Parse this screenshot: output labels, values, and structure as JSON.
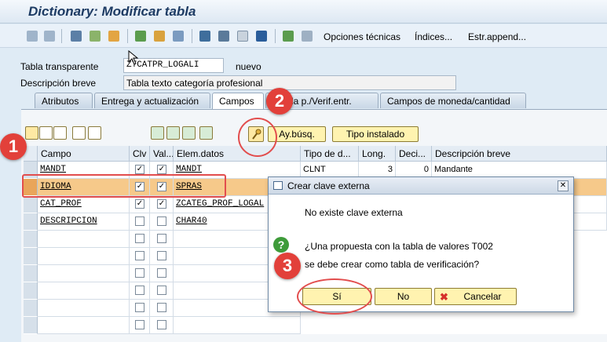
{
  "window": {
    "title": "Dictionary: Modificar tabla"
  },
  "toolbar": {
    "menu_items": [
      "Opciones técnicas",
      "Índices...",
      "Estr.append..."
    ]
  },
  "header": {
    "table_type_label": "Tabla transparente",
    "table_name": "ZTCATPR_LOGALI",
    "status": "nuevo",
    "desc_label": "Descripción breve",
    "desc_value": "Tabla texto categoría profesional"
  },
  "tabs": [
    "Atributos",
    "Entrega y actualización",
    "Campos",
    "da p./Verif.entr.",
    "Campos de moneda/cantidad"
  ],
  "active_tab": "Campos",
  "fields_toolbar": {
    "search_help_button": "Ay.búsq.",
    "builtin_type_button": "Tipo instalado"
  },
  "grid": {
    "columns": [
      "Campo",
      "Clv",
      "Val...",
      "Elem.datos",
      "Tipo de d...",
      "Long.",
      "Deci...",
      "Descripción breve"
    ],
    "rows": [
      {
        "campo": "MANDT",
        "clv": true,
        "val": true,
        "elem": "MANDT",
        "tipo": "CLNT",
        "long": "3",
        "deci": "0",
        "desc": "Mandante"
      },
      {
        "campo": "IDIOMA",
        "clv": true,
        "val": true,
        "elem": "SPRAS",
        "tipo": "",
        "long": "",
        "deci": "",
        "desc": ""
      },
      {
        "campo": "CAT_PROF",
        "clv": true,
        "val": true,
        "elem": "ZCATEG_PROF_LOGAL",
        "tipo": "",
        "long": "",
        "deci": "",
        "desc": ""
      },
      {
        "campo": "DESCRIPCION",
        "clv": false,
        "val": false,
        "elem": "CHAR40",
        "tipo": "",
        "long": "",
        "deci": "",
        "desc": ""
      }
    ]
  },
  "dialog": {
    "title": "Crear clave externa",
    "message1": "No existe clave externa",
    "question_line1": "¿Una propuesta con la tabla de valores T002",
    "question_line2": "se debe crear como tabla de verificación?",
    "yes_label": "Sí",
    "no_label": "No",
    "cancel_label": "Cancelar"
  },
  "callouts": [
    "1",
    "2",
    "3"
  ],
  "colors": {
    "callout": "#e2403a",
    "highlight_row": "#f6c98a",
    "button_yellow": "#fff3b0"
  }
}
